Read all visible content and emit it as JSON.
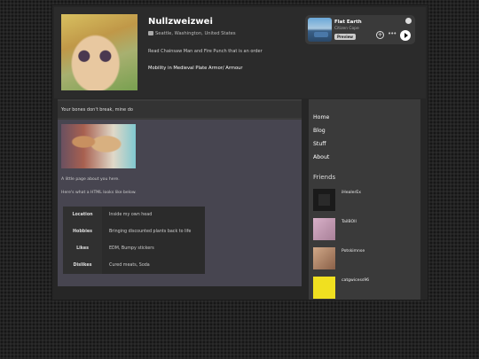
{
  "profile": {
    "name": "Nullzweizwei",
    "location": "Seattle, Washington, United States",
    "bio": "Read Chainsaw Man and Fire Punch that is an order",
    "mobility": "Mobility in Medieval Plate Armor/ Armour"
  },
  "player": {
    "track": "Flat Earth",
    "artist": "Citizen Cope",
    "badge": "Preview",
    "add_glyph": "+",
    "more_glyph": "•••"
  },
  "main": {
    "tagline": "Your bones don't break, mine do",
    "about": "A little page about you here.",
    "html_note": "Here's what a HTML looks like below.",
    "table": [
      {
        "key": "Location",
        "value": "Inside my own head"
      },
      {
        "key": "Hobbies",
        "value": "Bringing discounted plants back to life"
      },
      {
        "key": "Likes",
        "value": "EDM, Bumpy stickers"
      },
      {
        "key": "Dislikes",
        "value": "Cured meats, Soda"
      }
    ]
  },
  "sidebar": {
    "nav": [
      "Home",
      "Blog",
      "Stuff",
      "About"
    ],
    "friends_title": "Friends",
    "friends": [
      {
        "name": "iHealerEx",
        "color": "#2a2a2a"
      },
      {
        "name": "TailBOII",
        "color": "#c0a0b8"
      },
      {
        "name": "Potskimnse",
        "color": "#b89070"
      },
      {
        "name": "catgwicess96",
        "color": "#f0e020"
      }
    ]
  }
}
